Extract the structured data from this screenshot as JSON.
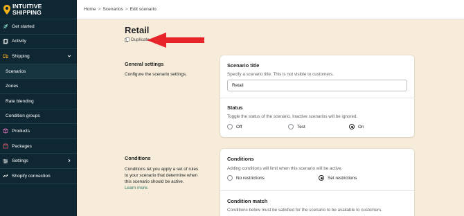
{
  "brand": {
    "line1": "INTUITIVE",
    "line2": "SHIPPING"
  },
  "sidebar": {
    "items": [
      {
        "label": "Get started",
        "icon": "rocket-icon"
      },
      {
        "label": "Activity",
        "icon": "activity-icon"
      },
      {
        "label": "Shipping",
        "icon": "shipping-icon"
      },
      {
        "label": "Scenarios"
      },
      {
        "label": "Zones"
      },
      {
        "label": "Rate blending"
      },
      {
        "label": "Condition groups"
      },
      {
        "label": "Products",
        "icon": "products-icon"
      },
      {
        "label": "Packages",
        "icon": "packages-icon"
      },
      {
        "label": "Settings",
        "icon": "settings-icon"
      },
      {
        "label": "Shopify connection",
        "icon": "shopify-icon"
      }
    ]
  },
  "breadcrumb": {
    "home": "Home",
    "scenarios": "Scenarios",
    "current": "Edit scenario",
    "sep": ">"
  },
  "page": {
    "title": "Retail",
    "duplicate": "Duplicate"
  },
  "general": {
    "title": "General settings",
    "desc": "Configure the scenario settings.",
    "scenario_title": {
      "label": "Scenario title",
      "help": "Specify a scenario title. This is not visible to customers.",
      "value": "Retail"
    },
    "status": {
      "label": "Status",
      "help": "Toggle the status of the scenario. Inactive scenarios will be ignored.",
      "options": [
        "Off",
        "Test",
        "On"
      ],
      "selected": "On"
    }
  },
  "conditions": {
    "title": "Conditions",
    "desc_line1": "Conditions let you apply a set of rules",
    "desc_line2": "to your scenario that determine when",
    "desc_line3": "this scenario should be active.",
    "learn_more": "Learn more.",
    "card": {
      "label": "Conditions",
      "help": "Adding conditions will limit when this scenario will be active.",
      "options": [
        "No restrictions",
        "Set restrictions"
      ],
      "selected": "Set restrictions"
    },
    "match": {
      "label": "Condition match",
      "help": "Conditions below must be satisfied for the scenario to be available to customers."
    }
  },
  "colors": {
    "sidebar": "#0f2733",
    "background": "#f6ecd9",
    "accent": "#e8242b",
    "logo": "#f5b11a"
  }
}
